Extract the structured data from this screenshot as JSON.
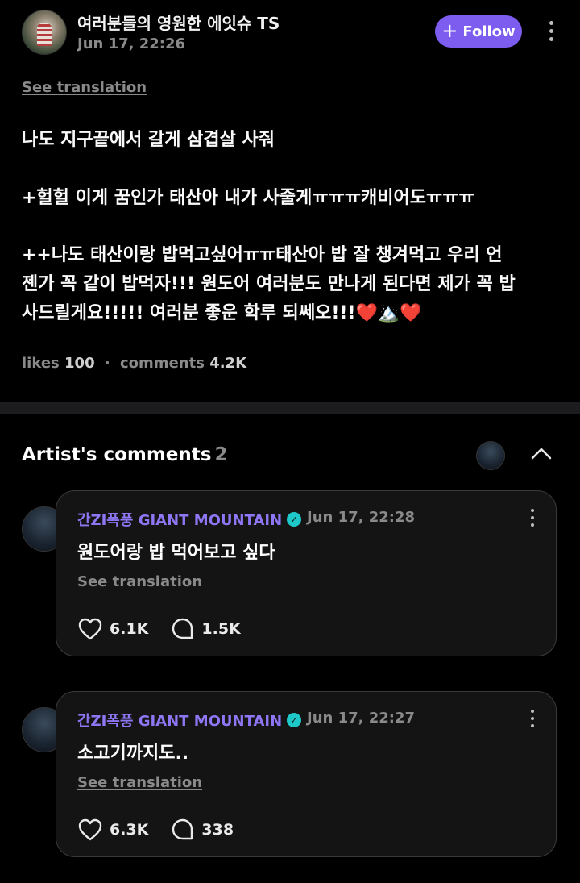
{
  "post": {
    "author": "여러분들의 영원한 에잇슈 TS",
    "date": "Jun 17, 22:26",
    "follow_label": "Follow",
    "see_translation": "See translation",
    "body_lines": [
      "나도 지구끝에서 갈게 삼겹살 사줘",
      "+헐헐 이게 꿈인가 태산아 내가 사줄게ㅠㅠㅠ캐비어도ㅠㅠㅠ",
      "++나도 태산이랑 밥먹고싶어ㅠㅠ태산아 밥 잘 챙겨먹고 우리 언",
      "젠가 꼭 같이 밥먹자!!! 원도어 여러분도 만나게 된다면 제가 꼭 밥",
      "사드릴게요!!!!! 여러분 좋운 학루 되쎄오!!!❤️🏔️❤️"
    ],
    "likes_label": "likes",
    "likes_value": "100",
    "separator": "·",
    "comments_label": "comments",
    "comments_value": "4.2K"
  },
  "artist_comments": {
    "title": "Artist's comments",
    "count": "2",
    "items": [
      {
        "author": "간ZI폭풍 GIANT MOUNTAIN",
        "date": "Jun 17, 22:28",
        "text": "원도어랑 밥 먹어보고 싶다",
        "see_translation": "See translation",
        "likes": "6.1K",
        "replies": "1.5K"
      },
      {
        "author": "간ZI폭풍 GIANT MOUNTAIN",
        "date": "Jun 17, 22:27",
        "text": "소고기까지도..",
        "see_translation": "See translation",
        "likes": "6.3K",
        "replies": "338"
      }
    ]
  },
  "colors": {
    "accent": "#7d5cf0",
    "artist_name": "#8f76f5",
    "verified": "#1fc8c8",
    "muted": "#8a8a8a"
  },
  "icons": {
    "follow": "plus-icon",
    "more": "more-vertical-icon",
    "collapse": "chevron-up-icon",
    "like": "heart-icon",
    "reply": "comment-bubble-icon",
    "verified": "verified-badge-icon"
  }
}
